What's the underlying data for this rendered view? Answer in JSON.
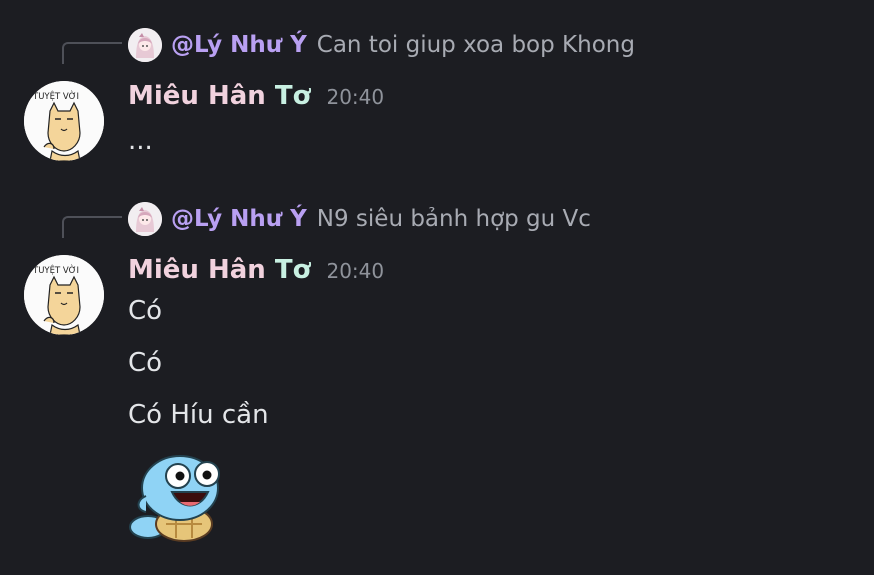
{
  "messages": [
    {
      "reply": {
        "username": "@Lý Như Ý",
        "text": "Can toi giup xoa bop Khong"
      },
      "author": {
        "name_first": "Miêu Hân",
        "name_last": "Tơ",
        "avatar_text": "TUYỆT VỜI"
      },
      "timestamp": "20:40",
      "lines": [
        "..."
      ]
    },
    {
      "reply": {
        "username": "@Lý Như Ý",
        "text": "N9 siêu bảnh hợp gu Vc"
      },
      "author": {
        "name_first": "Miêu Hân",
        "name_last": "Tơ",
        "avatar_text": "TUYỆT VỜI"
      },
      "timestamp": "20:40",
      "lines": [
        "Có",
        "Có",
        "Có Híu cần"
      ],
      "sticker": "squirtle-sticker"
    }
  ],
  "colors": {
    "background": "#1c1d22",
    "reply_username": "#b9a0f2",
    "author_name": "#f1d2de",
    "author_name_accent": "#c8f0e2"
  }
}
